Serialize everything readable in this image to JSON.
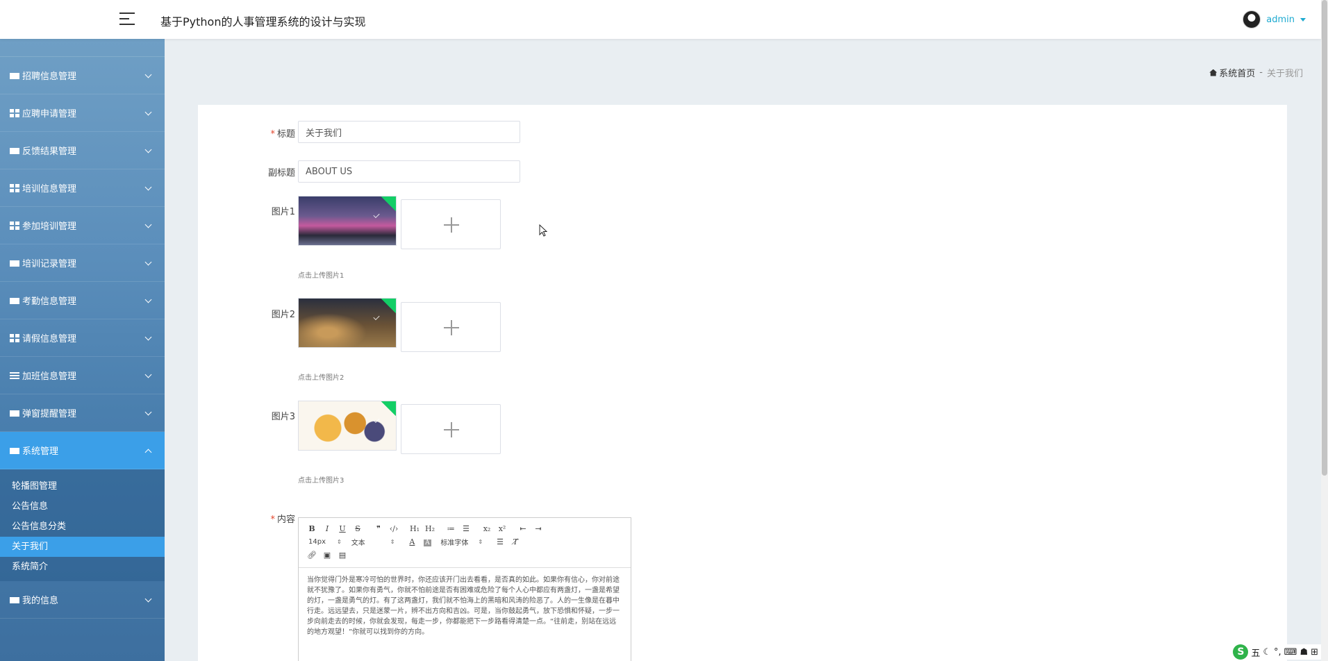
{
  "header": {
    "title": "基于Python的人事管理系统的设计与实现",
    "user": "admin"
  },
  "sidebar": {
    "items": [
      {
        "label": "招聘信息管理"
      },
      {
        "label": "应聘申请管理"
      },
      {
        "label": "反馈结果管理"
      },
      {
        "label": "培训信息管理"
      },
      {
        "label": "参加培训管理"
      },
      {
        "label": "培训记录管理"
      },
      {
        "label": "考勤信息管理"
      },
      {
        "label": "请假信息管理"
      },
      {
        "label": "加班信息管理"
      },
      {
        "label": "弹窗提醒管理"
      },
      {
        "label": "系统管理"
      }
    ],
    "submenu": [
      {
        "label": "轮播图管理"
      },
      {
        "label": "公告信息"
      },
      {
        "label": "公告信息分类"
      },
      {
        "label": "关于我们"
      },
      {
        "label": "系统简介"
      }
    ],
    "bottom_item": "我的信息"
  },
  "breadcrumb": {
    "home": "系统首页",
    "separator": "-",
    "current": "关于我们"
  },
  "form": {
    "title_label": "标题",
    "title_value": "关于我们",
    "subtitle_label": "副标题",
    "subtitle_value": "ABOUT US",
    "images": [
      {
        "label": "图片1",
        "hint": "点击上传图片1"
      },
      {
        "label": "图片2",
        "hint": "点击上传图片2"
      },
      {
        "label": "图片3",
        "hint": "点击上传图片3"
      }
    ],
    "content_label": "内容",
    "required_mark": "*"
  },
  "editor": {
    "toolbar_row1": [
      "B",
      "I",
      "U",
      "S",
      "❞",
      "‹/›",
      "H₁",
      "H₂",
      "≔",
      "☰",
      "x₂",
      "x²",
      "⇤",
      "⇥"
    ],
    "font_size": "14px",
    "text_style": "文本",
    "font_family": "标准字体",
    "content": "当你觉得门外是寒冷可怕的世界时，你还应该开门出去看看，是否真的如此。如果你有信心，你对前途就不犹豫了。如果你有勇气，你就不怕前途是否有困难或危险了每个人心中都应有两盏灯，一盏是希望的灯，一盏是勇气的灯。有了这两盏灯，我们就不怕海上的黑暗和风涛的险恶了。人的一生像是在暮中行走。远远望去，只是迷蒙一片，辨不出方向和吉凶。可是，当你鼓起勇气，放下恐惧和怀疑，一步一步向前走去的时候，你就会发现，每走一步，你都能把下一步路看得清楚一点。“往前走，别站在远远的地方观望！”你就可以找到你的方向。"
  },
  "tray": {
    "ime": "五"
  },
  "colors": {
    "accent": "#3b9fe8",
    "user_link": "#1eaad0",
    "required": "#e2442b"
  }
}
